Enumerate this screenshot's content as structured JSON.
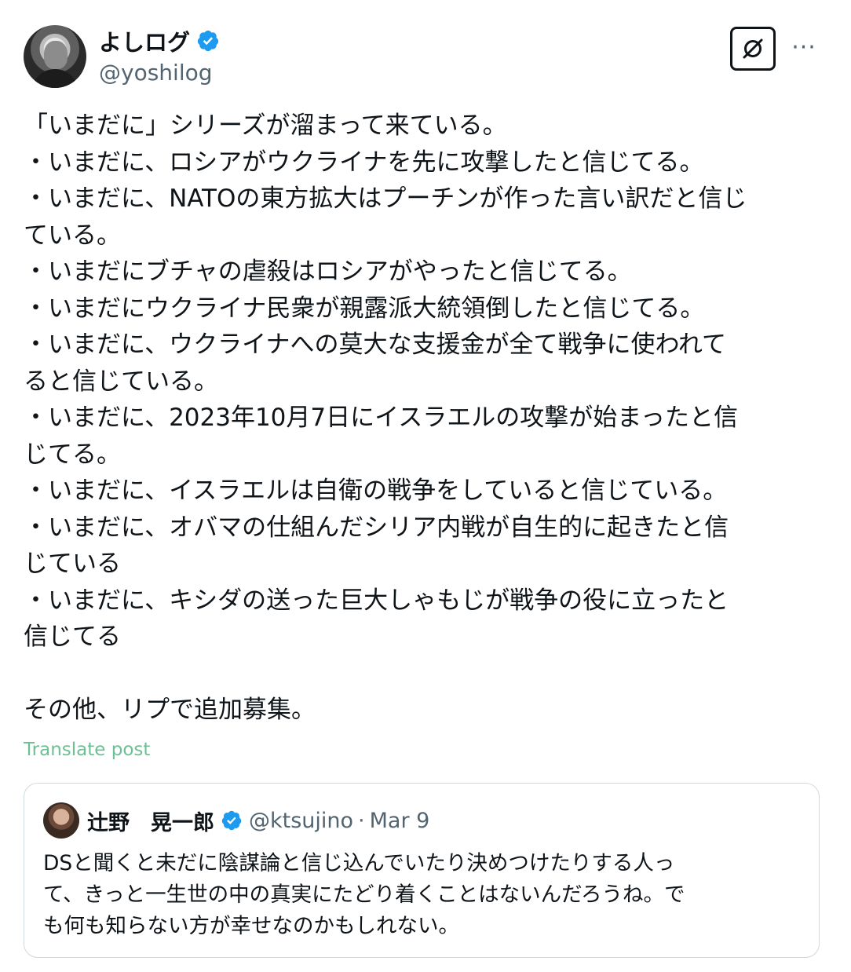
{
  "author": {
    "display_name": "よしログ",
    "handle": "@yoshilog",
    "verified_color": "#1d9bf0"
  },
  "actions": {
    "grok_icon": "slashed-circle-icon",
    "more_icon": "ellipsis-icon",
    "more_label": "···"
  },
  "post": {
    "lines": [
      "「いまだに」シリーズが溜まって来ている。",
      "・いまだに、ロシアがウクライナを先に攻撃したと信じてる。",
      "・いまだに、NATOの東方拡大はプーチンが作った言い訳だと信じ",
      "ている。",
      "・いまだにブチャの虐殺はロシアがやったと信じてる。",
      "・いまだにウクライナ民衆が親露派大統領倒したと信じてる。",
      "・いまだに、ウクライナへの莫大な支援金が全て戦争に使われて",
      "ると信じている。",
      "・いまだに、2023年10月7日にイスラエルの攻撃が始まったと信",
      "じてる。",
      "・いまだに、イスラエルは自衛の戦争をしていると信じている。",
      "・いまだに、オバマの仕組んだシリア内戦が自生的に起きたと信",
      "じている",
      "・いまだに、キシダの送った巨大しゃもじが戦争の役に立ったと",
      "信じてる",
      "",
      "その他、リプで追加募集。"
    ],
    "translate_label": "Translate post"
  },
  "quoted": {
    "display_name": "辻野　晃一郎",
    "handle": "@ktsujino",
    "separator": "·",
    "date": "Mar 9",
    "lines": [
      "DSと聞くと未だに陰謀論と信じ込んでいたり決めつけたりする人っ",
      "て、きっと一生世の中の真実にたどり着くことはないんだろうね。で",
      "も何も知らない方が幸せなのかもしれない。"
    ]
  }
}
